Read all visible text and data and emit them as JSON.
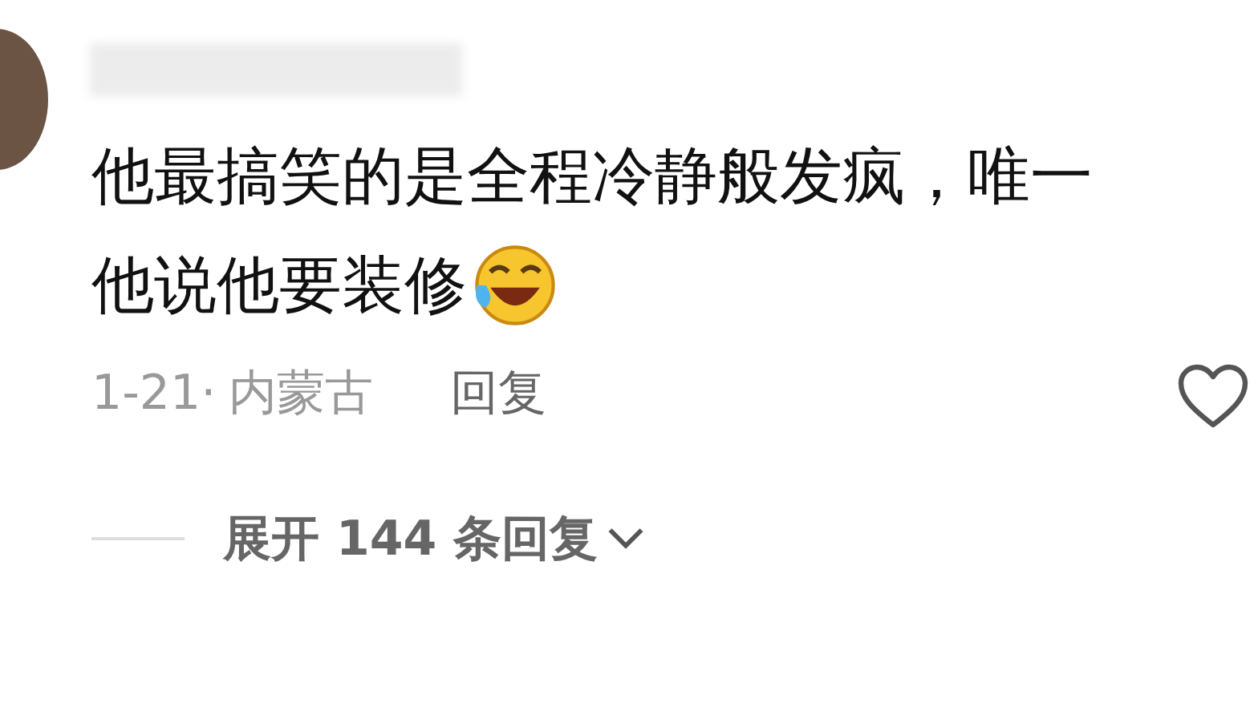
{
  "comment": {
    "text_lines": [
      "他最搞笑的是全程冷静般发疯，唯一",
      "他说他要装修"
    ],
    "date": "1-21·",
    "location": "内蒙古",
    "reply_label": "回复"
  },
  "expand_replies": {
    "label": "展开 144 条回复"
  }
}
